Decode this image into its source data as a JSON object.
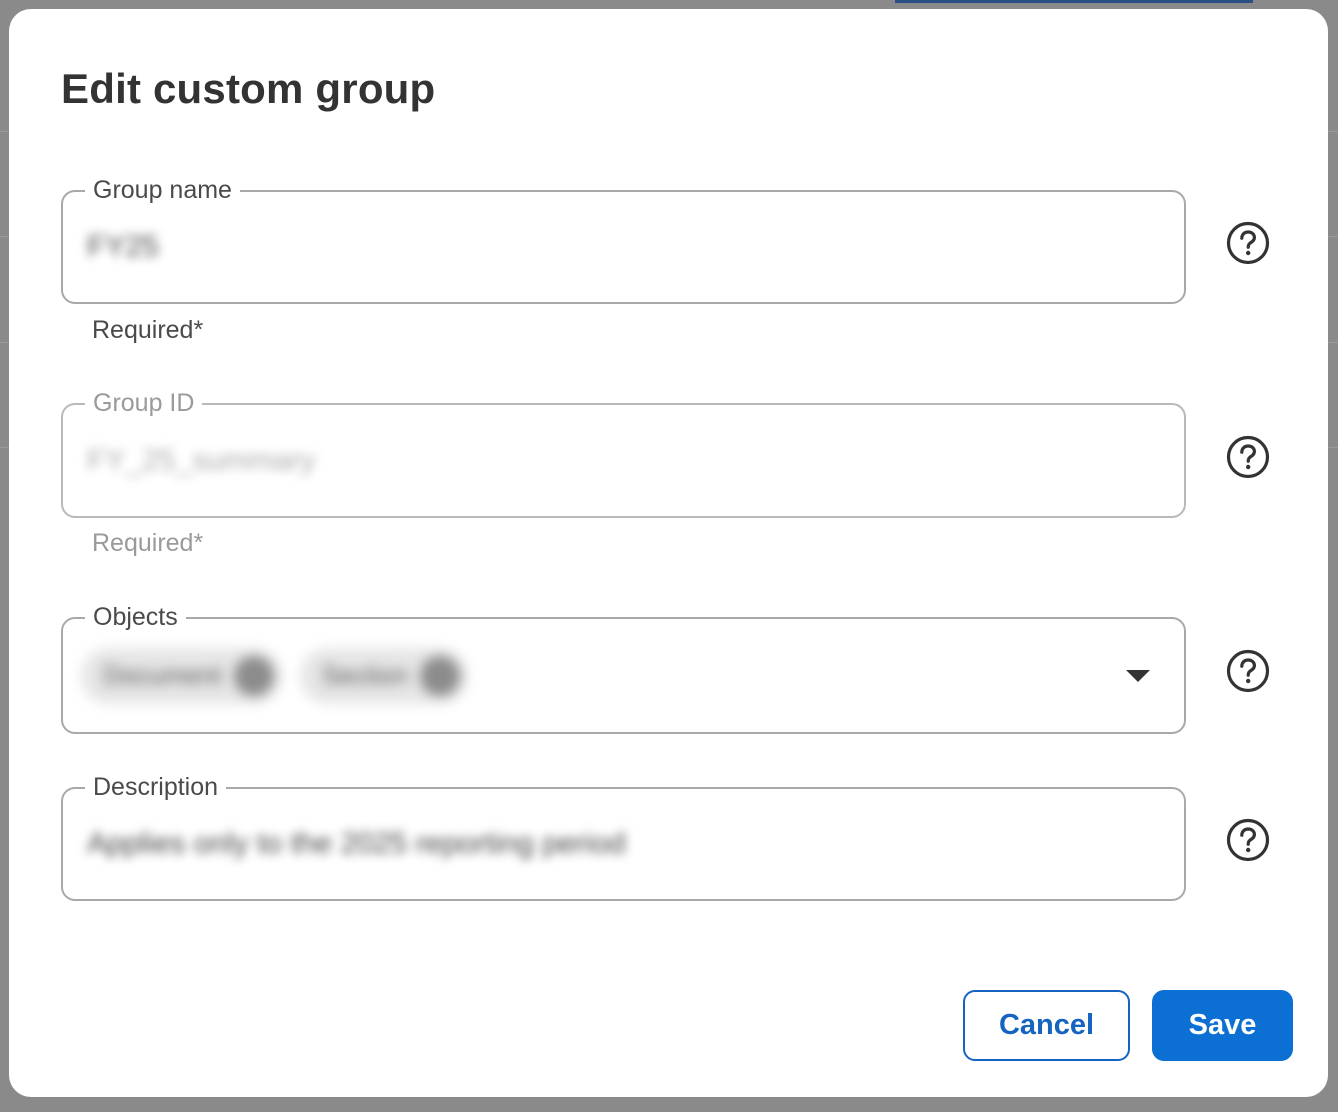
{
  "dialog": {
    "title": "Edit custom group",
    "fields": {
      "group_name": {
        "label": "Group name",
        "value": "FY25",
        "helper": "Required*"
      },
      "group_id": {
        "label": "Group ID",
        "value": "FY_25_summary",
        "helper": "Required*",
        "disabled": true
      },
      "objects": {
        "label": "Objects",
        "chips": [
          "Document",
          "Section"
        ]
      },
      "description": {
        "label": "Description",
        "value": "Applies only to the 2025 reporting period"
      }
    },
    "actions": {
      "cancel_label": "Cancel",
      "save_label": "Save"
    }
  },
  "icons": {
    "help": "help-circle-icon",
    "dropdown": "caret-down-icon",
    "chip_remove": "remove-chip-icon"
  },
  "colors": {
    "primary": "#0b6fd3",
    "primary_outline": "#1565c0",
    "text": "#333333",
    "border": "#a9a9a9",
    "disabled_text": "#9a9a9a",
    "backdrop": "#8a8a8a"
  }
}
